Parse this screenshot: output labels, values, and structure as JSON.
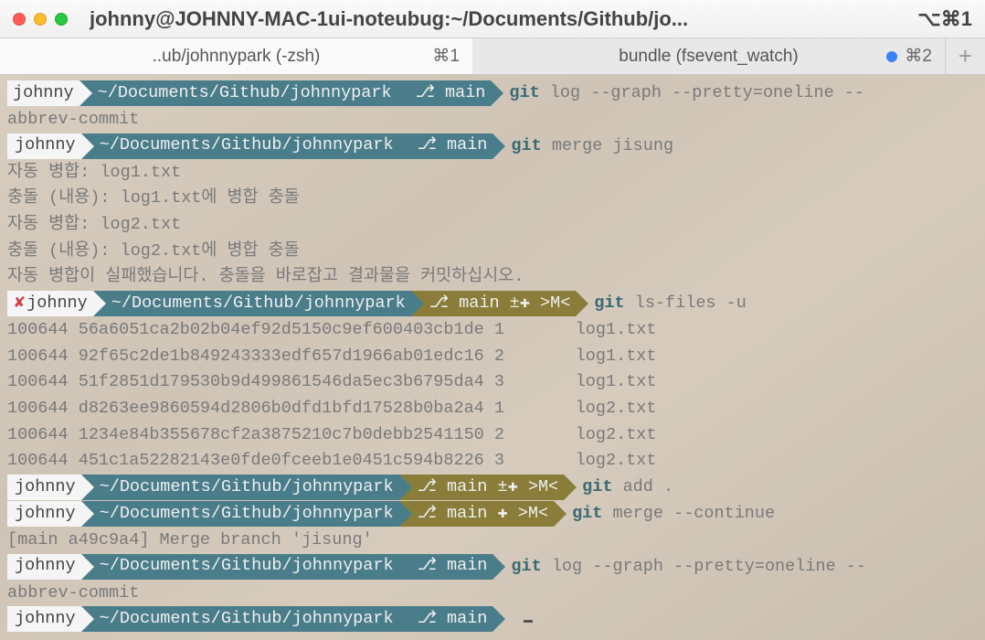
{
  "window": {
    "title": "johnny@JOHNNY-MAC-1ui-noteubug:~/Documents/Github/jo...",
    "shortcut": "⌥⌘1"
  },
  "tabs": [
    {
      "label": "..ub/johnnypark (-zsh)",
      "shortcut": "⌘1",
      "active": true,
      "modified": false
    },
    {
      "label": "bundle (fsevent_watch)",
      "shortcut": "⌘2",
      "active": false,
      "modified": true
    }
  ],
  "newtab_glyph": "+",
  "prompts": {
    "user": "johnny",
    "path": "~/Documents/Github/johnnypark",
    "branch_main": "⎇ main",
    "branch_conflict_pm": "⎇ main ±✚ >M<",
    "branch_conflict_p": "⎇ main ✚ >M<"
  },
  "commands": {
    "log": {
      "git": "git",
      "rest": " log --graph --pretty=oneline --"
    },
    "log_cont": "abbrev-commit",
    "merge": {
      "git": "git",
      "rest": " merge jisung"
    },
    "lsfiles": {
      "git": "git",
      "rest": " ls-files -u"
    },
    "add": {
      "git": "git",
      "rest": " add ."
    },
    "mergecontinue": {
      "git": "git",
      "rest": " merge --continue"
    }
  },
  "output": {
    "merge_out": [
      "자동 병합: log1.txt",
      "충돌 (내용): log1.txt에 병합 충돌",
      "자동 병합: log2.txt",
      "충돌 (내용): log2.txt에 병합 충돌",
      "자동 병합이 실패했습니다. 충돌을 바로잡고 결과물을 커밋하십시오."
    ],
    "lsfiles_out": [
      "100644 56a6051ca2b02b04ef92d5150c9ef600403cb1de 1       log1.txt",
      "100644 92f65c2de1b849243333edf657d1966ab01edc16 2       log1.txt",
      "100644 51f2851d179530b9d499861546da5ec3b6795da4 3       log1.txt",
      "100644 d8263ee9860594d2806b0dfd1bfd17528b0ba2a4 1       log2.txt",
      "100644 1234e84b355678cf2a3875210c7b0debb2541150 2       log2.txt",
      "100644 451c1a52282143e0fde0fceeb1e0451c594b8226 3       log2.txt"
    ],
    "merge_commit": "[main a49c9a4] Merge branch 'jisung'"
  }
}
